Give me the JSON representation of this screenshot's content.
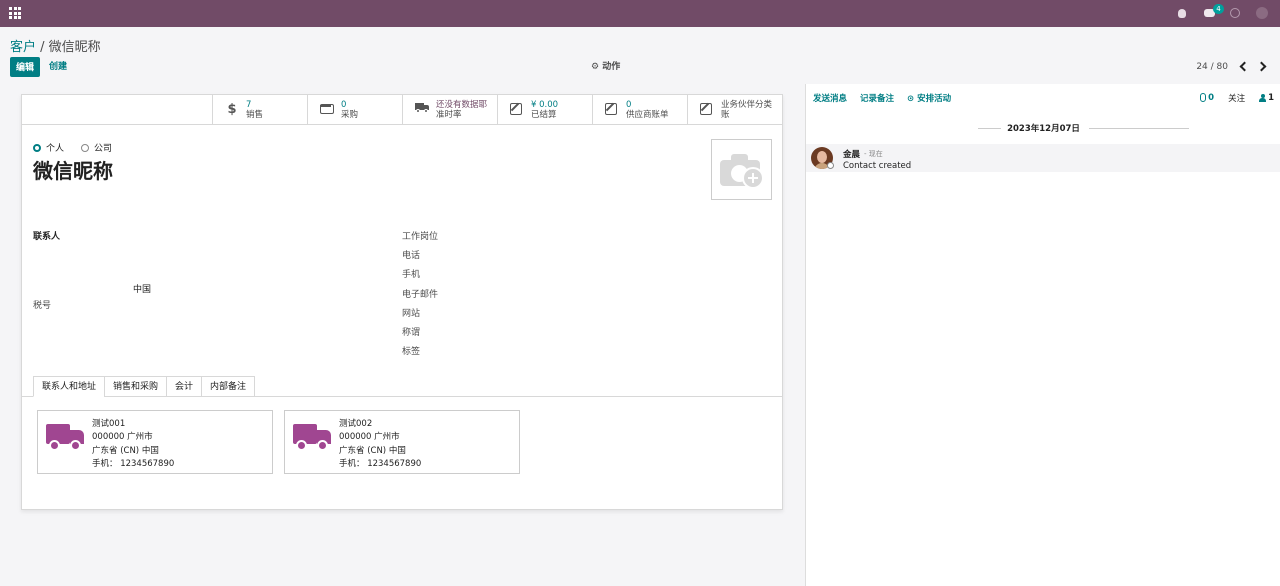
{
  "breadcrumb": {
    "parent": "客户",
    "separator": " / ",
    "current": "微信昵称"
  },
  "navbar": {
    "chat_badge": "4"
  },
  "buttons": {
    "edit": "编辑",
    "create": "创建",
    "action": "⚙ 动作"
  },
  "pager": {
    "value": "24 / 80"
  },
  "stat_buttons": [
    {
      "value": "7",
      "label": "销售",
      "icon": "dollar-icon"
    },
    {
      "value": "0",
      "label": "采购",
      "icon": "credit-card-icon"
    },
    {
      "value": "还没有数据耶",
      "label": "准时率",
      "icon": "truck-icon"
    },
    {
      "value": "¥ 0.00",
      "label": "已结算",
      "icon": "edit-icon"
    },
    {
      "value": "0",
      "label": "供应商账单",
      "icon": "edit-icon"
    },
    {
      "value": "",
      "label": "业务伙伴分类账",
      "icon": "edit-icon"
    }
  ],
  "company_type": {
    "individual": "个人",
    "company": "公司",
    "selected": "individual"
  },
  "partner": {
    "name": "微信昵称",
    "country": "中国"
  },
  "left_fields": {
    "contact": "联系人",
    "vat": "税号"
  },
  "right_fields": [
    "工作岗位",
    "电话",
    "手机",
    "电子邮件",
    "网站",
    "称谓",
    "标签"
  ],
  "tabs": [
    "联系人和地址",
    "销售和采购",
    "会计",
    "内部备注"
  ],
  "contacts": [
    {
      "name": "测试001",
      "line1": "000000 广州市",
      "line2": "广东省 (CN) 中国",
      "phone": "手机： 1234567890"
    },
    {
      "name": "测试002",
      "line1": "000000 广州市",
      "line2": "广东省 (CN) 中国",
      "phone": "手机： 1234567890"
    }
  ],
  "chatter": {
    "send_message": "发送消息",
    "log_note": "记录备注",
    "schedule_activity": "⊙ 安排活动",
    "attachments": "0",
    "follow": "关注",
    "followers": "1",
    "date": "2023年12月07日",
    "message": {
      "author": "金晨",
      "time": "- 现在",
      "body": "Contact created"
    }
  },
  "colors": {
    "navbar": "#714b67",
    "primary": "#017e84",
    "address_icon": "#a04691"
  }
}
